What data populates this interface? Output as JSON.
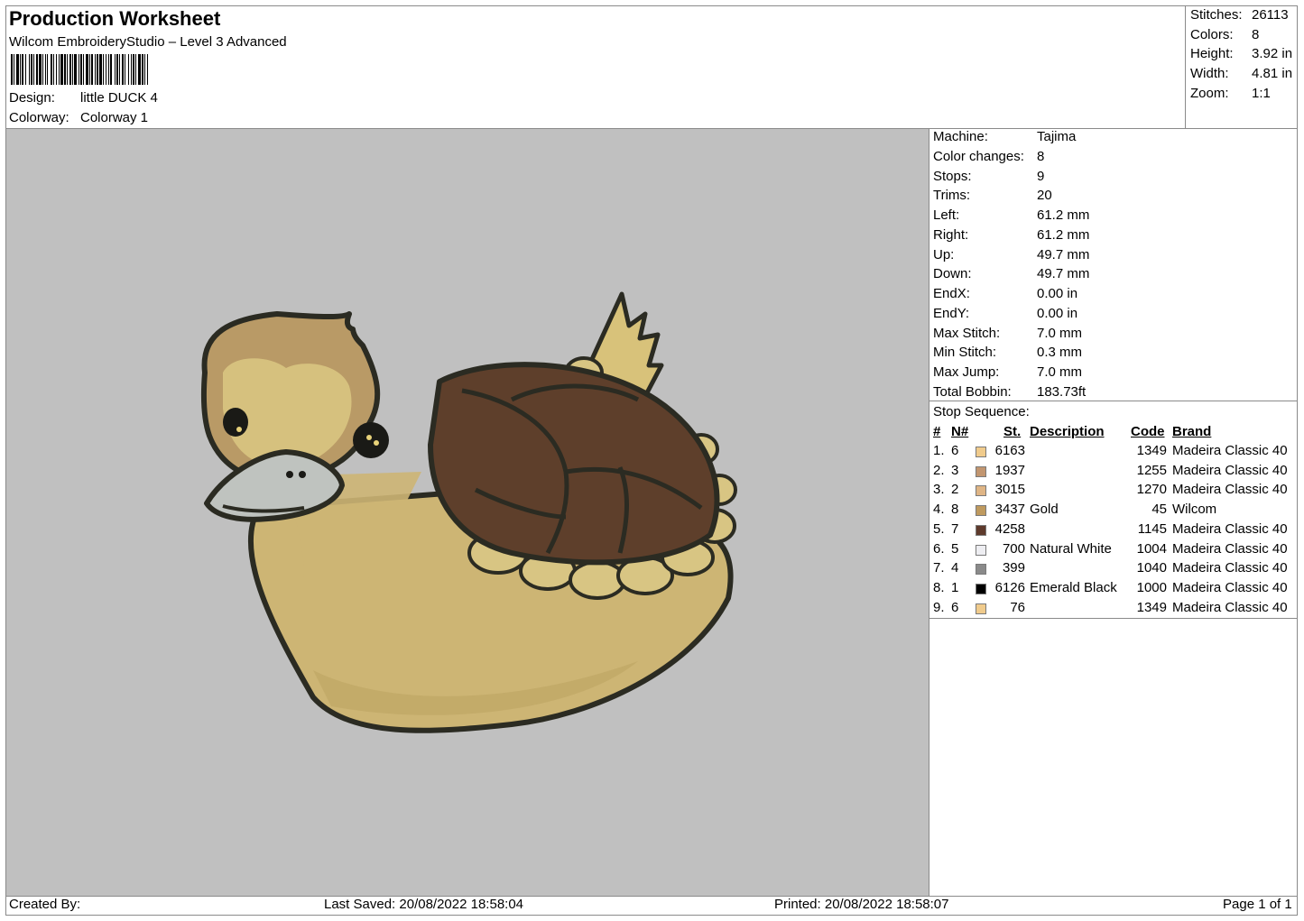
{
  "header": {
    "title": "Production Worksheet",
    "subtitle": "Wilcom EmbroideryStudio – Level 3 Advanced",
    "design_label": "Design:",
    "design_value": "little DUCK 4",
    "colorway_label": "Colorway:",
    "colorway_value": "Colorway 1"
  },
  "summary": [
    {
      "label": "Stitches:",
      "value": "26113"
    },
    {
      "label": "Colors:",
      "value": "8"
    },
    {
      "label": "Height:",
      "value": "3.92 in"
    },
    {
      "label": "Width:",
      "value": "4.81 in"
    },
    {
      "label": "Zoom:",
      "value": "1:1"
    }
  ],
  "stats": [
    {
      "label": "Machine:",
      "value": "Tajima"
    },
    {
      "label": "Color changes:",
      "value": "8"
    },
    {
      "label": "Stops:",
      "value": "9"
    },
    {
      "label": "Trims:",
      "value": "20"
    },
    {
      "label": "Left:",
      "value": "61.2 mm"
    },
    {
      "label": "Right:",
      "value": "61.2 mm"
    },
    {
      "label": "Up:",
      "value": "49.7 mm"
    },
    {
      "label": "Down:",
      "value": "49.7 mm"
    },
    {
      "label": "EndX:",
      "value": "0.00 in"
    },
    {
      "label": "EndY:",
      "value": "0.00 in"
    },
    {
      "label": "Max Stitch:",
      "value": "7.0 mm"
    },
    {
      "label": "Min Stitch:",
      "value": "0.3 mm"
    },
    {
      "label": "Max Jump:",
      "value": "7.0 mm"
    },
    {
      "label": "Total Bobbin:",
      "value": "183.73ft"
    }
  ],
  "stop_sequence": {
    "heading": "Stop Sequence:",
    "columns": {
      "idx": "#",
      "n": "N#",
      "st": "St.",
      "desc": "Description",
      "code": "Code",
      "brand": "Brand"
    },
    "rows": [
      {
        "idx": "1.",
        "n": "6",
        "color": "#f0cb8c",
        "st": "6163",
        "desc": "",
        "code": "1349",
        "brand": "Madeira Classic 40"
      },
      {
        "idx": "2.",
        "n": "3",
        "color": "#c29670",
        "st": "1937",
        "desc": "",
        "code": "1255",
        "brand": "Madeira Classic 40"
      },
      {
        "idx": "3.",
        "n": "2",
        "color": "#dfb585",
        "st": "3015",
        "desc": "",
        "code": "1270",
        "brand": "Madeira Classic 40"
      },
      {
        "idx": "4.",
        "n": "8",
        "color": "#bf9a5f",
        "st": "3437",
        "desc": "Gold",
        "code": "45",
        "brand": "Wilcom"
      },
      {
        "idx": "5.",
        "n": "7",
        "color": "#5e3a2c",
        "st": "4258",
        "desc": "",
        "code": "1145",
        "brand": "Madeira Classic 40"
      },
      {
        "idx": "6.",
        "n": "5",
        "color": "#eeeef2",
        "st": "700",
        "desc": "Natural White",
        "code": "1004",
        "brand": "Madeira Classic 40"
      },
      {
        "idx": "7.",
        "n": "4",
        "color": "#8a8a8a",
        "st": "399",
        "desc": "",
        "code": "1040",
        "brand": "Madeira Classic 40"
      },
      {
        "idx": "8.",
        "n": "1",
        "color": "#000000",
        "st": "6126",
        "desc": "Emerald Black",
        "code": "1000",
        "brand": "Madeira Classic 40"
      },
      {
        "idx": "9.",
        "n": "6",
        "color": "#f0cb8c",
        "st": "76",
        "desc": "",
        "code": "1349",
        "brand": "Madeira Classic 40"
      }
    ]
  },
  "footer": {
    "created_by": "Created By:",
    "last_saved": "Last Saved: 20/08/2022 18:58:04",
    "printed": "Printed: 20/08/2022 18:58:07",
    "page": "Page 1 of 1"
  },
  "colors": {
    "canvas_bg": "#c0c0c0",
    "border": "#8a8a8a"
  }
}
